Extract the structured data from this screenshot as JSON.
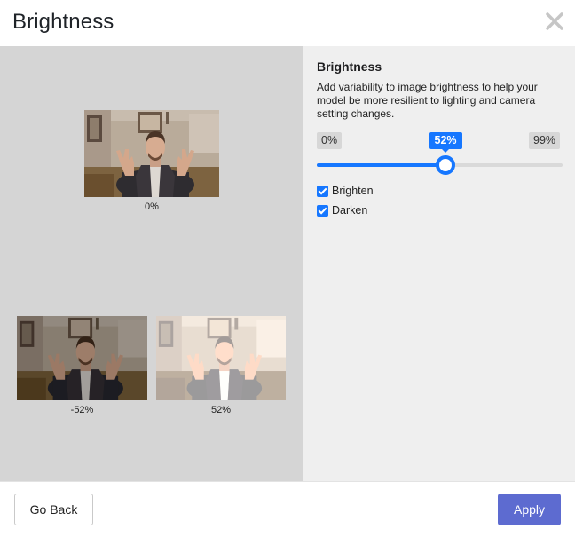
{
  "dialog": {
    "title": "Brightness",
    "close_icon": "close-icon"
  },
  "previews": {
    "original": {
      "caption": "0%",
      "brightness": 0
    },
    "darken": {
      "caption": "-52%",
      "brightness": -52
    },
    "brighten": {
      "caption": "52%",
      "brightness": 52
    }
  },
  "settings": {
    "title": "Brightness",
    "description": "Add variability to image brightness to help your model be more resilient to lighting and camera setting changes.",
    "slider": {
      "min_label": "0%",
      "max_label": "99%",
      "value_label": "52%",
      "min": 0,
      "max": 99,
      "value": 52
    },
    "options": [
      {
        "label": "Brighten",
        "checked": true
      },
      {
        "label": "Darken",
        "checked": true
      }
    ]
  },
  "footer": {
    "back_label": "Go Back",
    "apply_label": "Apply"
  },
  "colors": {
    "accent": "#1677ff",
    "apply": "#5d6bd0",
    "preview_bg": "#d5d5d5",
    "settings_bg": "#efefef"
  }
}
